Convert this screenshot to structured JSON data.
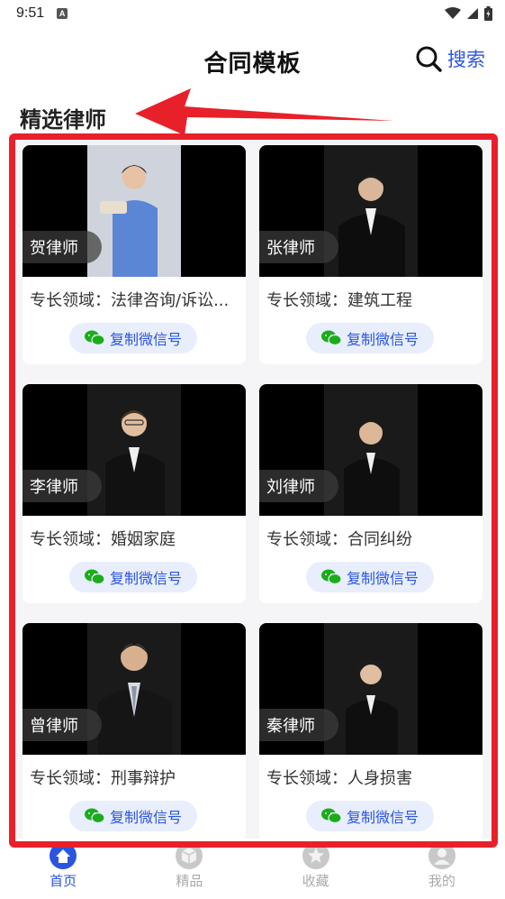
{
  "status": {
    "time": "9:51",
    "a_label": "A"
  },
  "header": {
    "title": "合同模板",
    "search_label": "搜索"
  },
  "section": {
    "title": "精选律师"
  },
  "lawyers": [
    {
      "name": "贺律师",
      "specialty": "专长领域：法律咨询/诉讼...",
      "copy_label": "复制微信号"
    },
    {
      "name": "张律师",
      "specialty": "专长领域：建筑工程",
      "copy_label": "复制微信号"
    },
    {
      "name": "李律师",
      "specialty": "专长领域：婚姻家庭",
      "copy_label": "复制微信号"
    },
    {
      "name": "刘律师",
      "specialty": "专长领域：合同纠纷",
      "copy_label": "复制微信号"
    },
    {
      "name": "曾律师",
      "specialty": "专长领域：刑事辩护",
      "copy_label": "复制微信号"
    },
    {
      "name": "秦律师",
      "specialty": "专长领域：人身损害",
      "copy_label": "复制微信号"
    }
  ],
  "tabs": [
    {
      "label": "首页",
      "icon": "home-icon",
      "active": true
    },
    {
      "label": "精品",
      "icon": "cube-icon",
      "active": false
    },
    {
      "label": "收藏",
      "icon": "star-icon",
      "active": false
    },
    {
      "label": "我的",
      "icon": "user-icon",
      "active": false
    }
  ],
  "colors": {
    "accent": "#2b55e0",
    "annotation": "#e8202a",
    "wechat_green": "#1aad19"
  }
}
